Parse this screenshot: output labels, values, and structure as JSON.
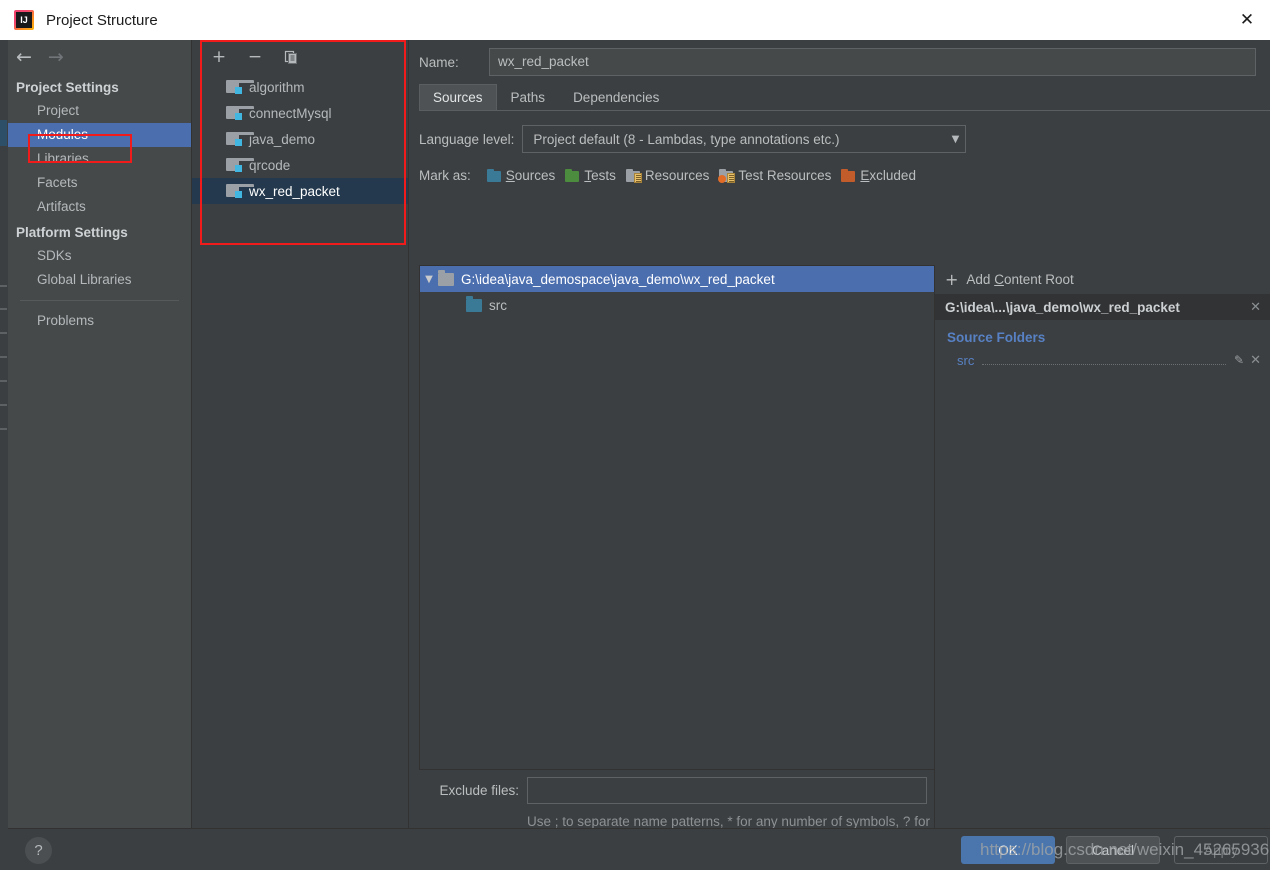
{
  "window": {
    "title": "Project Structure",
    "logo_text": "IJ",
    "close_label": "✕"
  },
  "nav": {
    "back_icon": "←",
    "forward_icon": "→",
    "groups": [
      {
        "label": "Project Settings",
        "items": [
          {
            "label": "Project",
            "selected": false
          },
          {
            "label": "Modules",
            "selected": true
          },
          {
            "label": "Libraries",
            "selected": false
          },
          {
            "label": "Facets",
            "selected": false
          },
          {
            "label": "Artifacts",
            "selected": false
          }
        ]
      },
      {
        "label": "Platform Settings",
        "items": [
          {
            "label": "SDKs",
            "selected": false
          },
          {
            "label": "Global Libraries",
            "selected": false
          }
        ]
      }
    ],
    "extra_items": [
      {
        "label": "Problems",
        "selected": false
      }
    ]
  },
  "modules": {
    "toolbar": {
      "add_label": "+",
      "remove_label": "−",
      "copy_label": "copy-icon"
    },
    "items": [
      {
        "label": "algorithm",
        "selected": false
      },
      {
        "label": "connectMysql",
        "selected": false
      },
      {
        "label": "java_demo",
        "selected": false
      },
      {
        "label": "qrcode",
        "selected": false
      },
      {
        "label": "wx_red_packet",
        "selected": true
      }
    ]
  },
  "main": {
    "name_label": "Name:",
    "name_value": "wx_red_packet",
    "tabs": [
      {
        "label": "Sources",
        "active": true
      },
      {
        "label": "Paths",
        "active": false
      },
      {
        "label": "Dependencies",
        "active": false
      }
    ],
    "language_level": {
      "label": "Language level:",
      "value": "Project default (8 - Lambdas, type annotations etc.)",
      "caret": "▼"
    },
    "mark_as": {
      "label": "Mark as:",
      "options": [
        {
          "label": "Sources",
          "mnemonic": "S",
          "rest": "ources",
          "color": "#3b7a96",
          "kind": "plain"
        },
        {
          "label": "Tests",
          "mnemonic": "T",
          "rest": "ests",
          "color": "#4c8c3f",
          "kind": "plain"
        },
        {
          "label": "Resources",
          "mnemonic": "",
          "rest": "Resources",
          "color": "#9aa0a6",
          "kind": "lines"
        },
        {
          "label": "Test Resources",
          "mnemonic": "",
          "rest": "Test Resources",
          "color": "#9aa0a6",
          "kind": "lines-warn"
        },
        {
          "label": "Excluded",
          "mnemonic": "E",
          "rest": "xcluded",
          "color": "#c25c2a",
          "kind": "plain"
        }
      ]
    },
    "tree": {
      "root": {
        "arrow": "▼",
        "label": "G:\\idea\\java_demospace\\java_demo\\wx_red_packet",
        "folder_color": "#9aa0a6",
        "selected": true
      },
      "children": [
        {
          "label": "src",
          "folder_color": "#3b7a96",
          "selected": false
        }
      ]
    },
    "exclude": {
      "label": "Exclude files:",
      "value": "",
      "hint": "Use ; to separate name patterns, * for any number of symbols, ? for one."
    }
  },
  "detail": {
    "add_content_root": {
      "plus": "+",
      "label": "Add Content Root"
    },
    "content_root": {
      "label": "G:\\idea\\...\\java_demo\\wx_red_packet",
      "close": "✕"
    },
    "source_folders_title": "Source Folders",
    "source_folders": [
      {
        "label": "src",
        "edit_icon": "✎",
        "delete_icon": "✕"
      }
    ]
  },
  "footer": {
    "help_label": "?",
    "ok_label": "OK",
    "cancel_label": "Cancel",
    "apply_label": "Apply"
  },
  "watermark": "https://blog.csdn.net/weixin_45265936",
  "colors": {
    "accent_blue": "#4b6eaf",
    "selection_dark": "#24394d",
    "link_blue": "#5781c4",
    "annotation_red": "#f21b1b",
    "panel_bg": "#3c3f41",
    "nav_bg": "#45494a"
  }
}
